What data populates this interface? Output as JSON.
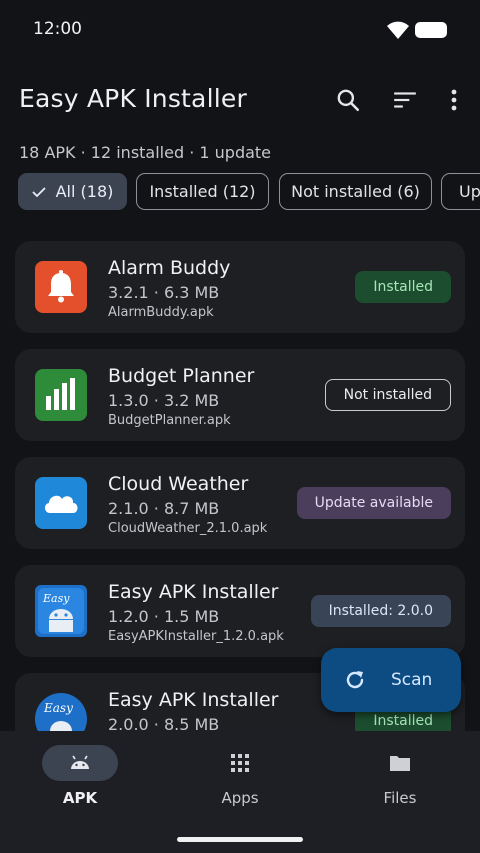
{
  "status": {
    "time": "12:00"
  },
  "app": {
    "title": "Easy APK Installer"
  },
  "summary": "18 APK · 12 installed · 1 update",
  "chips": [
    {
      "label": "All (18)",
      "selected": true
    },
    {
      "label": "Installed (12)",
      "selected": false
    },
    {
      "label": "Not installed (6)",
      "selected": false
    },
    {
      "label": "Up",
      "selected": false
    }
  ],
  "apps": [
    {
      "name": "Alarm Buddy",
      "meta": "3.2.1 · 6.3 MB",
      "file": "AlarmBuddy.apk",
      "status": "Installed",
      "icon": "bell-icon",
      "color": "#e4502b"
    },
    {
      "name": "Budget Planner",
      "meta": "1.3.0 · 3.2 MB",
      "file": "BudgetPlanner.apk",
      "status": "Not installed",
      "icon": "bar-chart-icon",
      "color": "#2e8b3a"
    },
    {
      "name": "Cloud Weather",
      "meta": "2.1.0 · 8.7 MB",
      "file": "CloudWeather_2.1.0.apk",
      "status": "Update available",
      "icon": "cloud-icon",
      "color": "#1f88d8"
    },
    {
      "name": "Easy APK Installer",
      "meta": "1.2.0 · 1.5 MB",
      "file": "EasyAPKInstaller_1.2.0.apk",
      "status": "Installed: 2.0.0",
      "icon": "easy-android-icon",
      "color": "#1e6fc8"
    },
    {
      "name": "Easy APK Installer",
      "meta": "2.0.0 · 8.5 MB",
      "file": "",
      "status": "Installed",
      "icon": "easy-android-icon",
      "color": "#1e6fc8"
    }
  ],
  "fab": {
    "label": "Scan"
  },
  "nav": [
    {
      "label": "APK",
      "active": true,
      "icon": "android-icon"
    },
    {
      "label": "Apps",
      "active": false,
      "icon": "grid-icon"
    },
    {
      "label": "Files",
      "active": false,
      "icon": "folder-icon"
    }
  ],
  "colors": {
    "accent": "#0d4c83",
    "installed": "#1b4d2e",
    "update": "#4b3d5c",
    "background": "#121316",
    "card": "#1e1f23"
  }
}
